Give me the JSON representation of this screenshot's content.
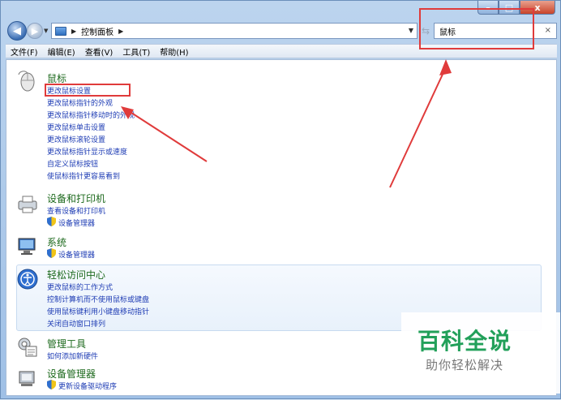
{
  "window": {
    "caption": {
      "minimize": "–",
      "maximize": "□",
      "close": "x"
    }
  },
  "navbar": {
    "address_path": "控制面板",
    "search_value": "鼠标",
    "search_clear": "×"
  },
  "menu": [
    "文件(F)",
    "编辑(E)",
    "查看(V)",
    "工具(T)",
    "帮助(H)"
  ],
  "groups": {
    "mouse": {
      "title": "鼠标",
      "links": [
        "更改鼠标设置",
        "更改鼠标指针的外观",
        "更改鼠标指针移动时的外观",
        "更改鼠标单击设置",
        "更改鼠标滚轮设置",
        "更改鼠标指针显示或速度",
        "自定义鼠标按钮",
        "使鼠标指针更容易看到"
      ]
    },
    "devices": {
      "title": "设备和打印机",
      "links": [
        "查看设备和打印机",
        "设备管理器"
      ]
    },
    "system": {
      "title": "系统",
      "links": [
        "设备管理器"
      ]
    },
    "ease": {
      "title": "轻松访问中心",
      "links": [
        "更改鼠标的工作方式",
        "控制计算机而不使用鼠标或键盘",
        "使用鼠标键利用小键盘移动指针",
        "关闭自动窗口排列"
      ]
    },
    "admin": {
      "title": "管理工具",
      "links": [
        "如何添加新硬件"
      ]
    },
    "devmgr": {
      "title": "设备管理器",
      "links": [
        "更新设备驱动程序"
      ]
    }
  },
  "watermark": {
    "title": "百科全说",
    "subtitle": "助你轻松解决"
  },
  "colors": {
    "group_title": "#1e6a1e",
    "link": "#1e3cb4",
    "annotation": "#e03b3b",
    "watermark": "#22a05a"
  }
}
